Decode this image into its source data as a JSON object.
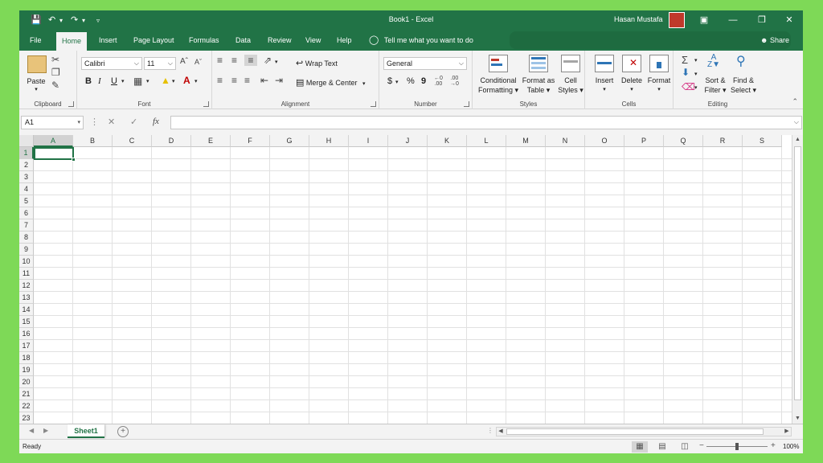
{
  "titlebar": {
    "title": "Book1  -  Excel",
    "user": "Hasan Mustafa",
    "save_icon": "save-icon",
    "undo_icon": "undo-icon",
    "redo_icon": "redo-icon"
  },
  "tabs": [
    "File",
    "Home",
    "Insert",
    "Page Layout",
    "Formulas",
    "Data",
    "Review",
    "View",
    "Help"
  ],
  "tellme": "Tell me what you want to do",
  "share": "Share",
  "ribbon": {
    "clipboard": {
      "label": "Clipboard",
      "paste": "Paste"
    },
    "font": {
      "label": "Font",
      "family": "Calibri",
      "size": "11",
      "bold": "B",
      "italic": "I",
      "underline": "U"
    },
    "alignment": {
      "label": "Alignment",
      "wrap": "Wrap Text",
      "merge": "Merge & Center"
    },
    "number": {
      "label": "Number",
      "format": "General",
      "currency": "$",
      "percent": "%",
      "comma": "9"
    },
    "styles": {
      "label": "Styles",
      "cond1": "Conditional",
      "cond2": "Formatting",
      "table1": "Format as",
      "table2": "Table",
      "cell1": "Cell",
      "cell2": "Styles"
    },
    "cells": {
      "label": "Cells",
      "insert": "Insert",
      "delete": "Delete",
      "format": "Format"
    },
    "editing": {
      "label": "Editing",
      "sort1": "Sort &",
      "sort2": "Filter",
      "find1": "Find &",
      "find2": "Select"
    }
  },
  "formula": {
    "namebox": "A1",
    "fx": "fx"
  },
  "columns": [
    "A",
    "B",
    "C",
    "D",
    "E",
    "F",
    "G",
    "H",
    "I",
    "J",
    "K",
    "L",
    "M",
    "N",
    "O",
    "P",
    "Q",
    "R",
    "S"
  ],
  "rows": [
    "1",
    "2",
    "3",
    "4",
    "5",
    "6",
    "7",
    "8",
    "9",
    "10",
    "11",
    "12",
    "13",
    "14",
    "15",
    "16",
    "17",
    "18",
    "19",
    "20",
    "21",
    "22",
    "23"
  ],
  "sheet": {
    "name": "Sheet1"
  },
  "status": {
    "ready": "Ready",
    "zoom": "100%",
    "zoom_fraction": 0.5
  },
  "colors": {
    "accent": "#217346",
    "background": "#7ed957"
  }
}
